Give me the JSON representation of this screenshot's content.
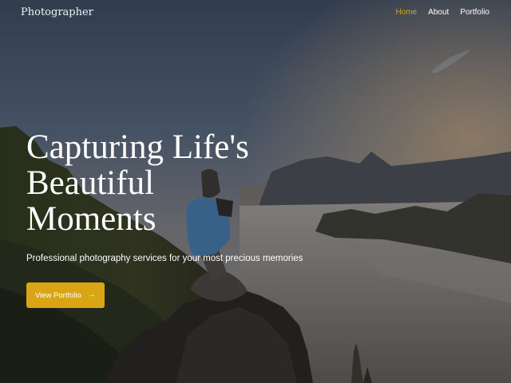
{
  "brand": {
    "name": "Photographer"
  },
  "nav": {
    "items": [
      {
        "label": "Home",
        "active": true
      },
      {
        "label": "About",
        "active": false
      },
      {
        "label": "Portfolio",
        "active": false
      }
    ]
  },
  "hero": {
    "title": "Capturing Life's Beautiful Moments",
    "subtitle": "Professional photography services for your most precious memories",
    "cta_label": "View Portfolio",
    "cta_icon": "arrow-right-icon",
    "background": "photographer-sitting-on-rock-above-misty-mountain-valley"
  },
  "colors": {
    "accent": "#d9a514",
    "nav_active": "#d6a318",
    "text": "#ffffff"
  }
}
